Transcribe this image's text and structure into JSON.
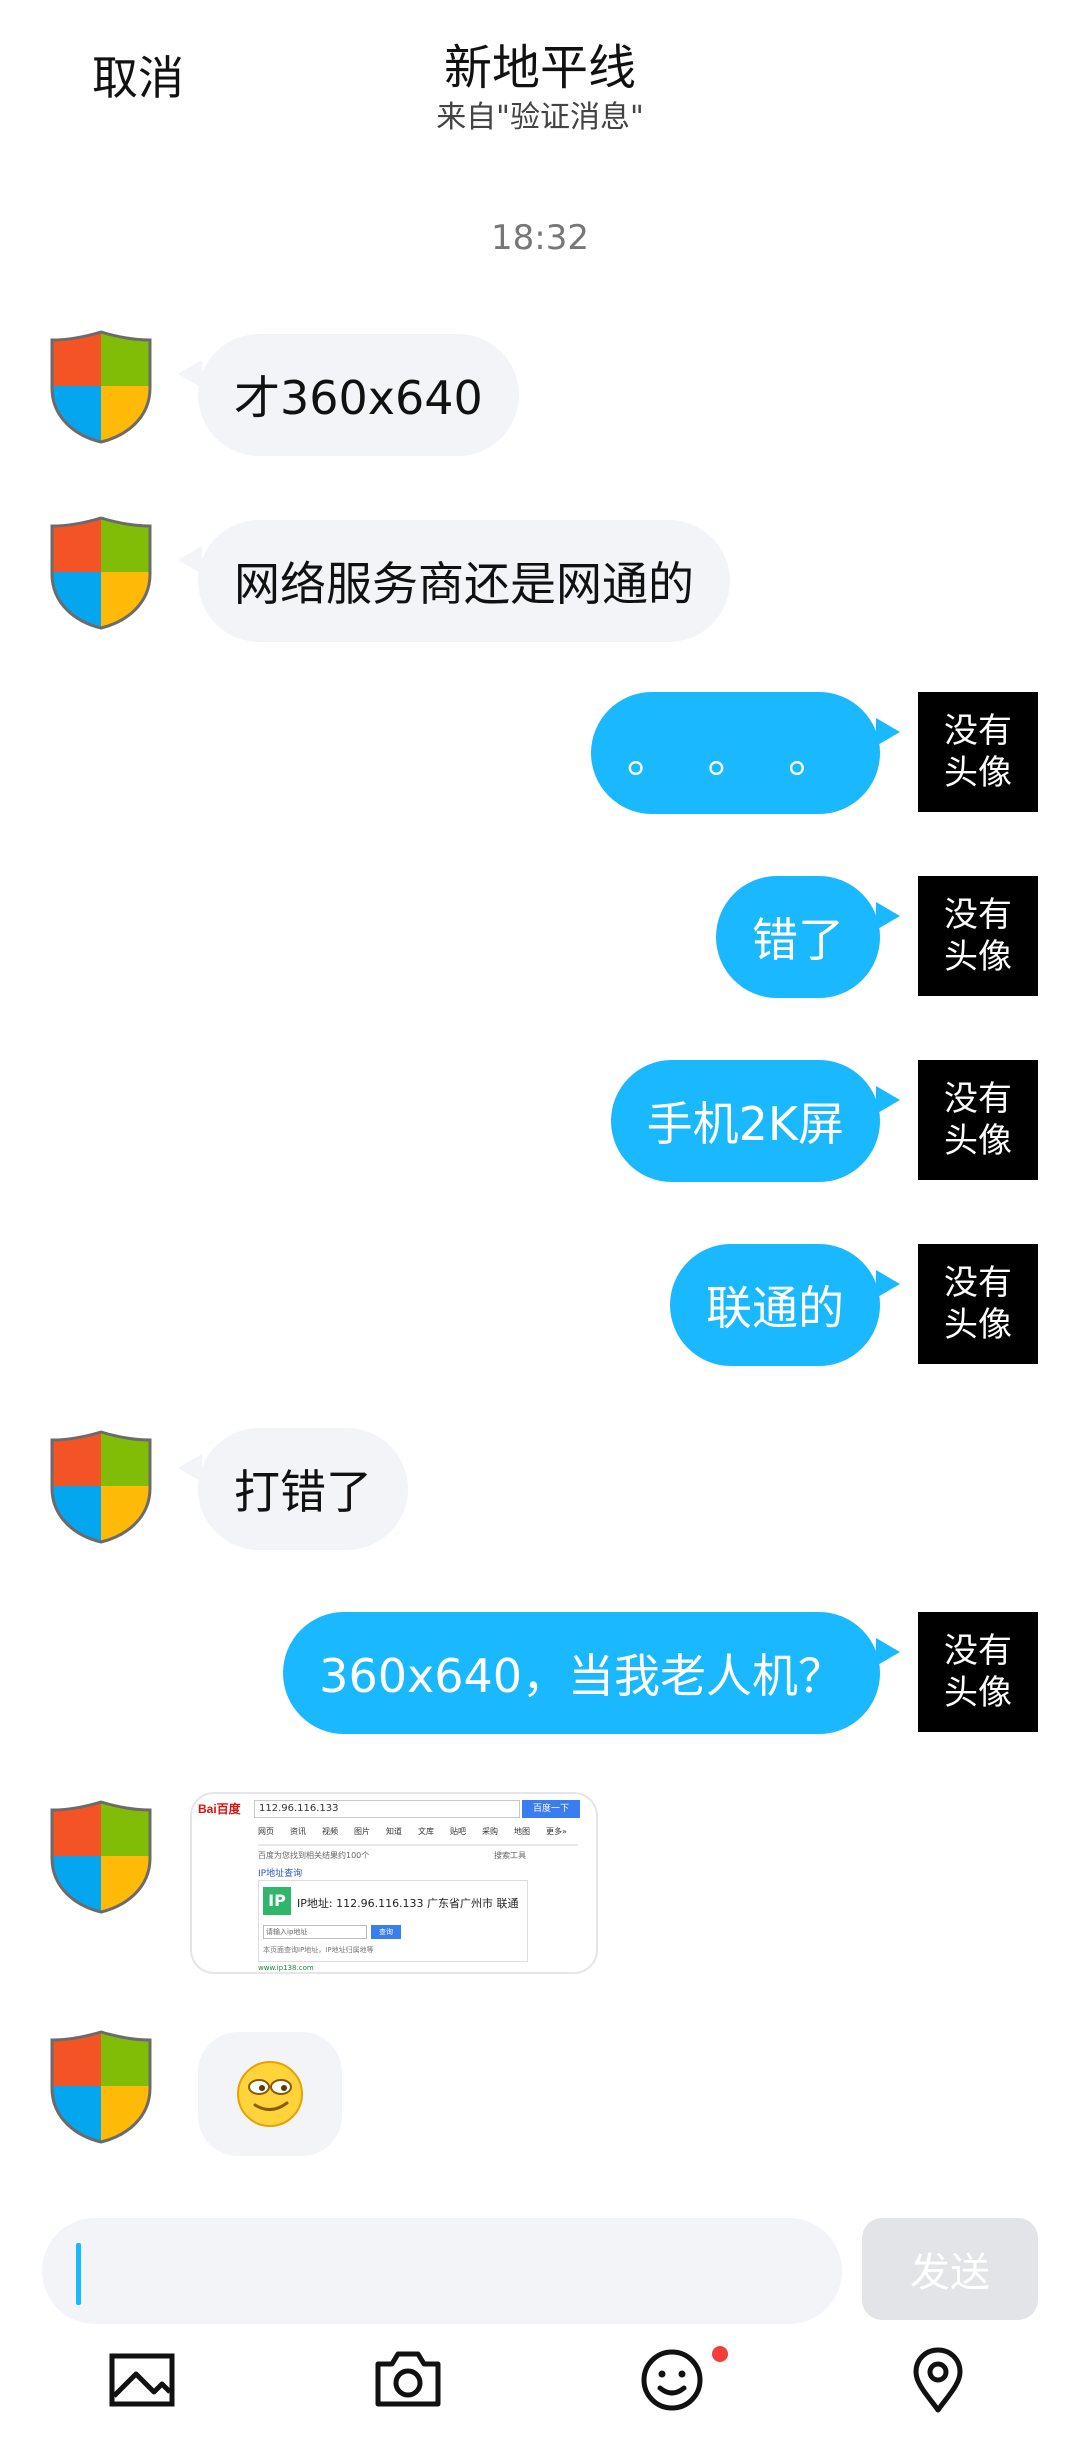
{
  "header": {
    "cancel_label": "取消",
    "title": "新地平线",
    "subtitle": "来自\"验证消息\""
  },
  "chat": {
    "timestamp": "18:32",
    "no_avatar_label": "没有\n头像",
    "messages": [
      {
        "side": "in",
        "text": "才360x640"
      },
      {
        "side": "in",
        "text": "网络服务商还是网通的"
      },
      {
        "side": "out",
        "text": "。 。 。"
      },
      {
        "side": "out",
        "text": "错了"
      },
      {
        "side": "out",
        "text": "手机2K屏"
      },
      {
        "side": "out",
        "text": "联通的"
      },
      {
        "side": "in",
        "text": "打错了"
      },
      {
        "side": "out",
        "text": "360x640，当我老人机？"
      },
      {
        "side": "in",
        "type": "image",
        "image": {
          "search_value": "112.96.116.133",
          "search_button": "百度一下",
          "tabs": [
            "网页",
            "资讯",
            "视频",
            "图片",
            "知道",
            "文库",
            "贴吧",
            "采购",
            "地图",
            "更多»"
          ],
          "note_left": "百度为您找到相关结果约100个",
          "note_right": "搜索工具",
          "tool_name": "IP地址查询",
          "ip_badge": "IP",
          "ip_result": "IP地址: 112.96.116.133 广东省广州市 联通",
          "input_placeholder": "请输入ip地址",
          "query_button": "查询",
          "hint": "本页面查询IP地址，IP地址归属地等",
          "url_text": "www.ip138.com"
        }
      },
      {
        "side": "in",
        "type": "emoji",
        "emoji": "smug-face"
      }
    ]
  },
  "composer": {
    "input_value": "",
    "send_label": "发送"
  },
  "toolbar": {
    "icons": [
      "image-icon",
      "camera-icon",
      "emoji-icon",
      "location-icon"
    ],
    "emoji_badge": true
  },
  "colors": {
    "outgoing_bubble": "#19b8ff",
    "incoming_bubble": "#f3f4f8",
    "send_disabled": "#e3e4e8",
    "badge": "#f33c3c"
  }
}
